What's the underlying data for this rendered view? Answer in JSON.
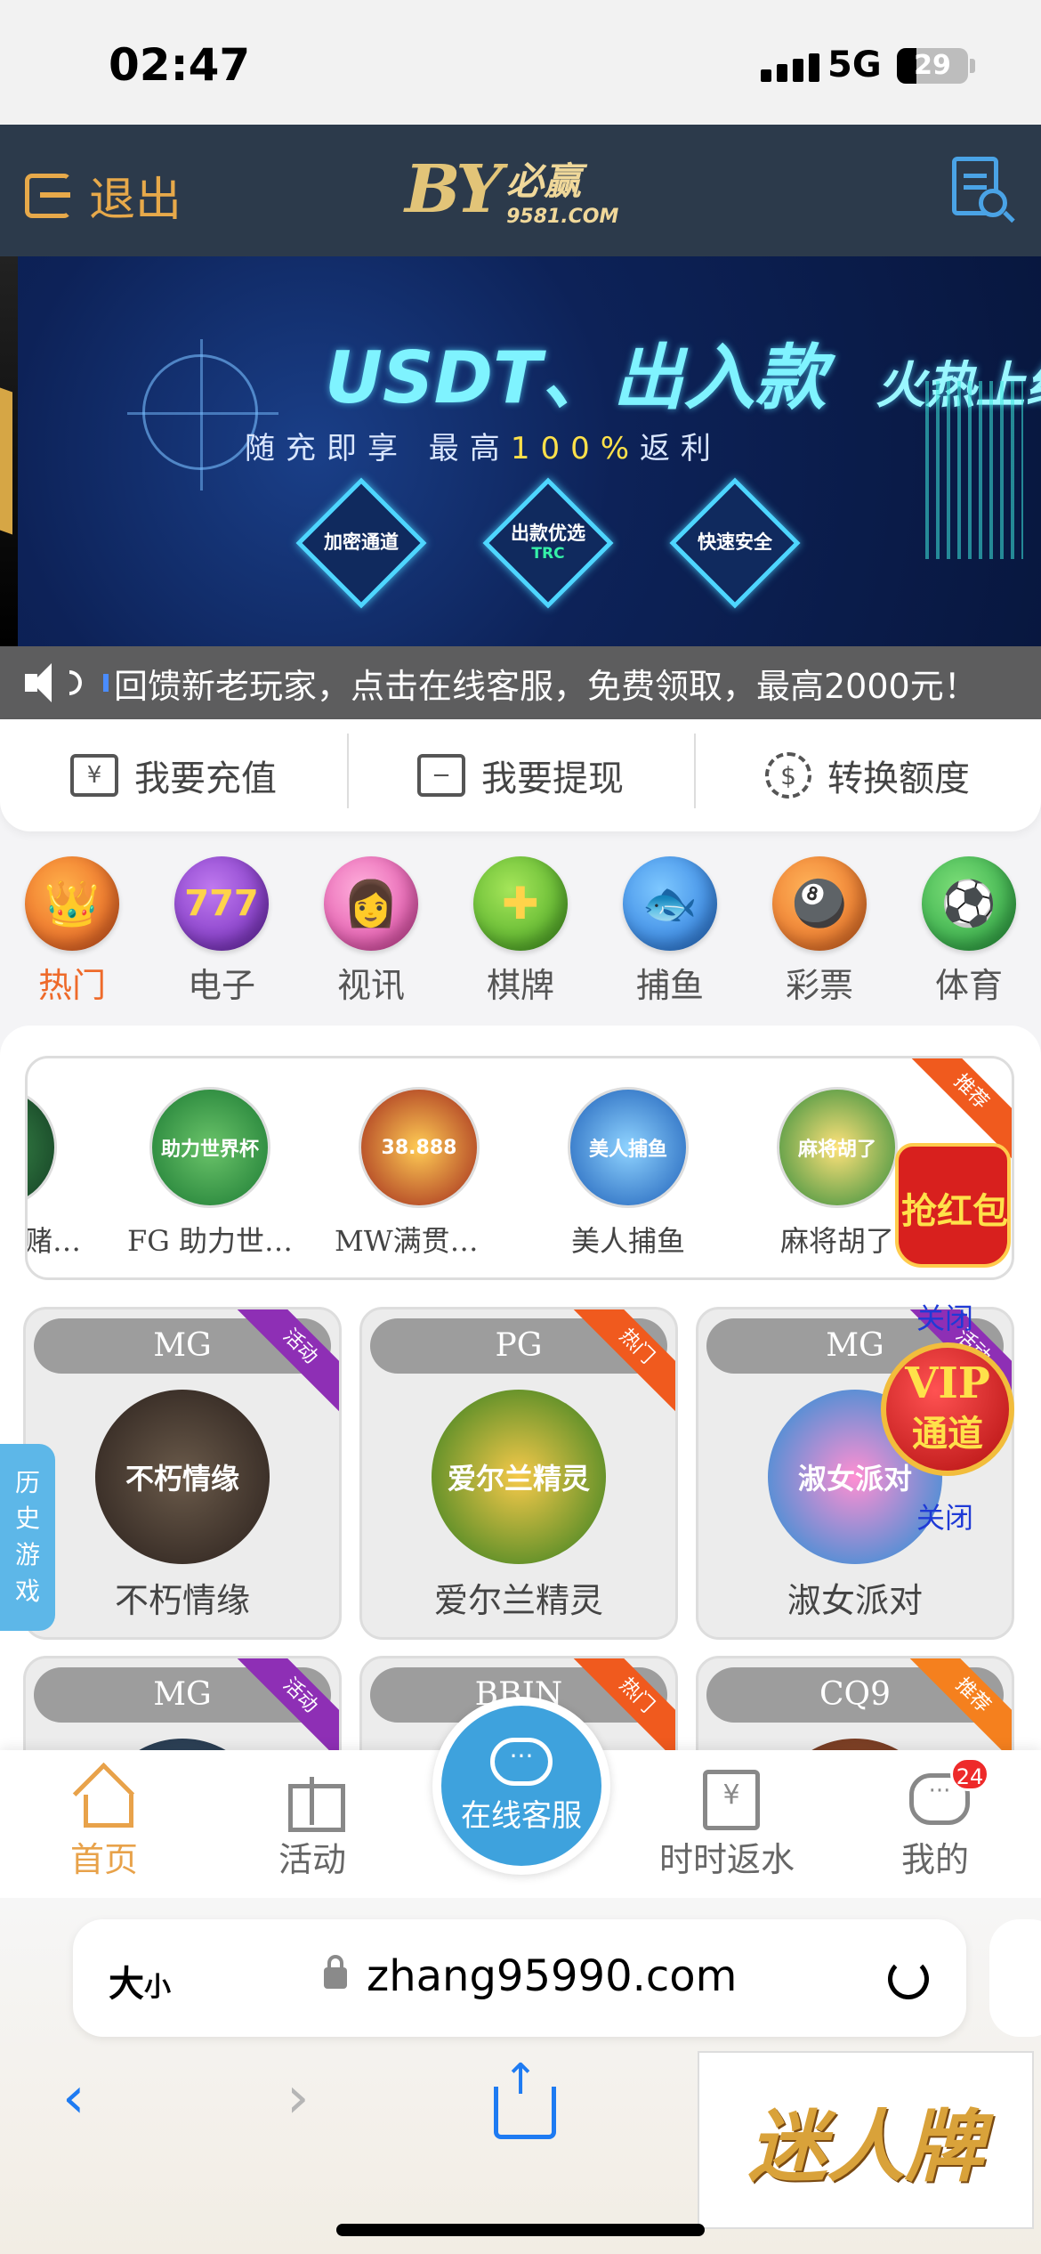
{
  "status": {
    "time": "02:47",
    "network": "5G",
    "battery": "29"
  },
  "header": {
    "logout_label": "退出",
    "brand_mark": "BY",
    "brand_cn": "必赢",
    "brand_url": "9581.COM"
  },
  "banner": {
    "headline": "USDT、出入款",
    "headline_sub": "火热上线",
    "tagline_start": "随充即享  最高",
    "tagline_highlight": "100%",
    "tagline_end": "返利",
    "badges": [
      {
        "label": "加密通道",
        "sub": ""
      },
      {
        "label": "出款优选",
        "sub": "TRC"
      },
      {
        "label": "快速安全",
        "sub": ""
      }
    ]
  },
  "marquee": {
    "text": "回馈新老玩家，点击在线客服，免费领取，最高2000元！"
  },
  "actions": [
    {
      "label": "我要充值",
      "icon": "deposit-icon"
    },
    {
      "label": "我要提现",
      "icon": "withdraw-icon"
    },
    {
      "label": "转换额度",
      "icon": "transfer-icon"
    }
  ],
  "categories": [
    {
      "label": "热门",
      "icon": "crown-icon",
      "active": true
    },
    {
      "label": "电子",
      "icon": "slot-777-icon",
      "active": false
    },
    {
      "label": "视讯",
      "icon": "live-dealer-icon",
      "active": false
    },
    {
      "label": "棋牌",
      "icon": "chess-coin-icon",
      "active": false
    },
    {
      "label": "捕鱼",
      "icon": "fish-icon",
      "active": false
    },
    {
      "label": "彩票",
      "icon": "lottery-balls-icon",
      "active": false
    },
    {
      "label": "体育",
      "icon": "soccer-ball-icon",
      "active": false
    }
  ],
  "recent": {
    "ribbon": "推荐",
    "items": [
      {
        "name": "赌…",
        "art": ""
      },
      {
        "name": "FG 助力世…",
        "art": "助力世界杯"
      },
      {
        "name": "MW满贯七…",
        "art": "38.888"
      },
      {
        "name": "美人捕鱼",
        "art": "美人捕鱼"
      },
      {
        "name": "麻将胡了",
        "art": "麻将胡了"
      }
    ]
  },
  "games": [
    {
      "provider": "MG",
      "ribbon": "活动",
      "name": "不朽情缘",
      "art": "不朽情缘"
    },
    {
      "provider": "PG",
      "ribbon": "热门",
      "name": "爱尔兰精灵",
      "art": "爱尔兰精灵"
    },
    {
      "provider": "MG",
      "ribbon": "活动",
      "name": "淑女派对",
      "art": "淑女派对"
    },
    {
      "provider": "MG",
      "ribbon": "活动",
      "name": "",
      "art": ""
    },
    {
      "provider": "BBIN",
      "ribbon": "热门",
      "name": "",
      "art": ""
    },
    {
      "provider": "CQ9",
      "ribbon": "推荐",
      "name": "",
      "art": ""
    }
  ],
  "floating": {
    "history_tab": [
      "历",
      "史",
      "游",
      "戏"
    ],
    "red_packet": "抢红包",
    "vip_title": "VIP",
    "vip_sub": "通道",
    "close_label": "关闭"
  },
  "tabbar": {
    "home": "首页",
    "activity": "活动",
    "service": "在线客服",
    "rebate": "时时返水",
    "mine": "我的",
    "mine_badge": "24"
  },
  "browser": {
    "text_size": "大",
    "text_size_small": "小",
    "url": "zhang95990.com"
  },
  "ad": {
    "text": "迷人牌"
  },
  "colors": {
    "header_bg": "#2c3a4b",
    "accent": "#e8a24a",
    "active_category": "#ee6a2a",
    "service_blue": "#3ea2dd"
  }
}
